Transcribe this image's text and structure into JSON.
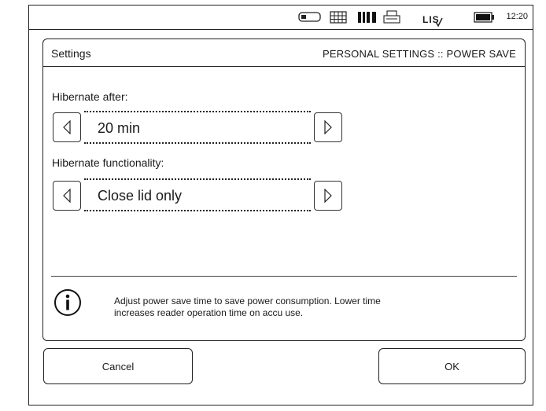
{
  "statusbar": {
    "icons": [
      "usb-stick-icon",
      "keyboard-icon",
      "barcode-icon",
      "printer-icon",
      "lis-connection-icon",
      "battery-icon"
    ],
    "lis_label": "LIS",
    "time": "12:20"
  },
  "panel": {
    "title": "Settings",
    "breadcrumb": "PERSONAL SETTINGS :: POWER SAVE"
  },
  "fields": {
    "hibernate_after": {
      "label": "Hibernate after:",
      "value": "20 min"
    },
    "hibernate_functionality": {
      "label": "Hibernate functionality:",
      "value": "Close lid only"
    }
  },
  "info": {
    "icon": "info-icon",
    "line1": "Adjust power save time to save power consumption. Lower time",
    "line2": "increases reader operation time on accu use."
  },
  "buttons": {
    "cancel": "Cancel",
    "ok": "OK"
  }
}
